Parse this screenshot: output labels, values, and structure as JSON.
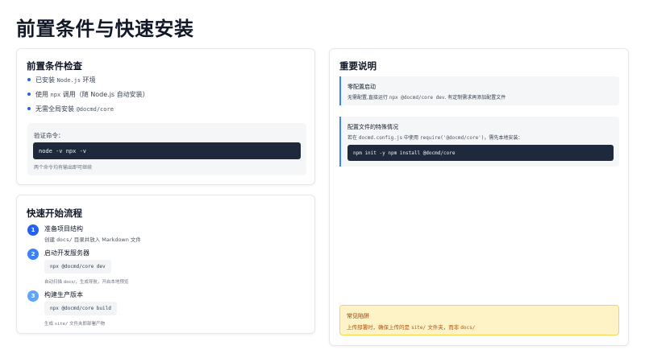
{
  "page": {
    "title": "前置条件与快速安装"
  },
  "prereq": {
    "title": "前置条件检查",
    "items": [
      {
        "before": "已安装 ",
        "code": "Node.js",
        "after": " 环境"
      },
      {
        "before": "使用 ",
        "code": "npx",
        "after": " 调用（随 Node.js 自动安装）"
      },
      {
        "before": "无需全局安装 ",
        "code": "@docmd/core",
        "after": ""
      }
    ],
    "verify_label": "验证命令：",
    "verify_code": "node -v npx -v",
    "verify_note": "两个命令均有输出即可继续"
  },
  "quick": {
    "title": "快速开始流程",
    "steps": [
      {
        "num": "1",
        "title": "准备项目结构",
        "desc_before": "创建 ",
        "desc_code": "docs/",
        "desc_after": " 目录并放入 Markdown 文件",
        "color": "#2563eb"
      },
      {
        "num": "2",
        "title": "启动开发服务器",
        "code": "npx @docmd/core dev",
        "note": "自动扫描 docs/，生成导航，开启本地预览",
        "color": "#3b82f6"
      },
      {
        "num": "3",
        "title": "构建生产版本",
        "code": "npx @docmd/core build",
        "note_before": "生成 ",
        "note_code": "site/",
        "note_after": " 文件夹即部署产物",
        "color": "#60a5fa"
      }
    ]
  },
  "notes": {
    "title": "重要说明",
    "zero_config": {
      "title": "零配置启动",
      "text_before": "无需配置,直接运行 ",
      "text_code": "npx @docmd/core dev",
      "text_after": ". 有定制需求再添加配置文件"
    },
    "config_case": {
      "title": "配置文件的特殊情况",
      "text_before": "若在 ",
      "text_code1": "docmd.config.js",
      "text_mid": " 中使用 ",
      "text_code2": "require('@docmd/core')",
      "text_after": "，需先本地安装：",
      "code": "npm init -y npm install @docmd/core"
    },
    "pitfall": {
      "title": "常见陷阱",
      "text_before": "上传部署时，确保上传的是 ",
      "text_code1": "site/",
      "text_mid": " 文件夹，而非 ",
      "text_code2": "docs/"
    }
  },
  "colors": {
    "accent": "#2563eb",
    "code_bg": "#1e293b",
    "warn_bg": "#fef3c7"
  }
}
